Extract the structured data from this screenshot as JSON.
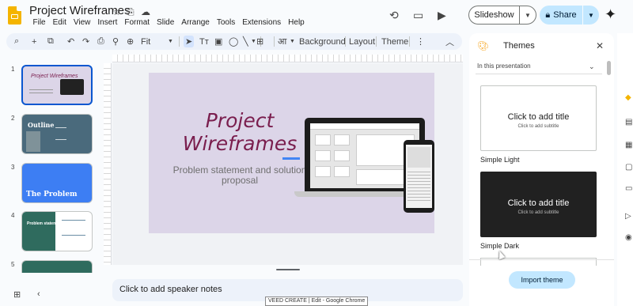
{
  "app": {
    "doc_title": "Project Wireframes",
    "menu": [
      "File",
      "Edit",
      "View",
      "Insert",
      "Format",
      "Slide",
      "Arrange",
      "Tools",
      "Extensions",
      "Help"
    ],
    "slideshow_label": "Slideshow",
    "share_label": "Share"
  },
  "toolbar": {
    "zoom_value": "Fit",
    "background_label": "Background",
    "layout_label": "Layout",
    "theme_label": "Theme"
  },
  "filmstrip": {
    "slides": [
      {
        "number": "1",
        "title": "Project Wireframes"
      },
      {
        "number": "2",
        "title": "Outline"
      },
      {
        "number": "3",
        "title": "The Problem"
      },
      {
        "number": "4",
        "title": "Problem statement"
      },
      {
        "number": "5",
        "title": ""
      }
    ]
  },
  "slide": {
    "title": "Project Wireframes",
    "subtitle": "Problem statement and solution proposal"
  },
  "notes": {
    "placeholder": "Click to add speaker notes"
  },
  "tooltip": "VEED CREATE | Edit - Google Chrome",
  "themes_panel": {
    "title": "Themes",
    "scope_label": "In this presentation",
    "cards": [
      {
        "name": "Simple Light",
        "title": "Click to add title",
        "subtitle": "Click to add subtitle"
      },
      {
        "name": "Simple Dark",
        "title": "Click to add title",
        "subtitle": "Click to add subtitle"
      }
    ],
    "import_label": "Import theme"
  },
  "colors": {
    "accent": "#0b57d0",
    "share_bg": "#c2e7ff",
    "slide_title": "#7a1e4e",
    "slide_bg": "#dcd5e8"
  }
}
